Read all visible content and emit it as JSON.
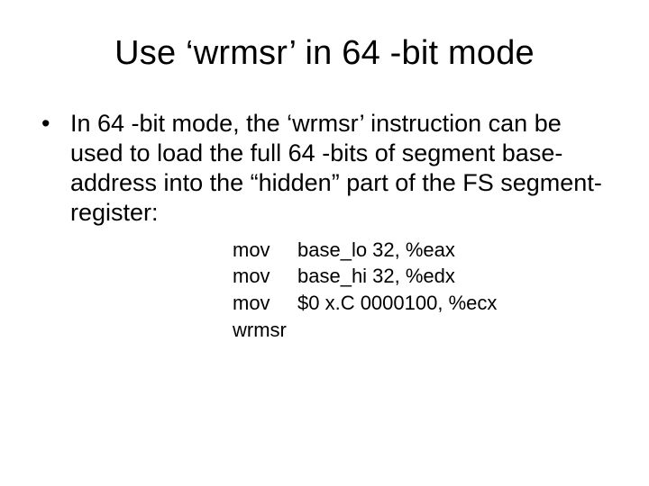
{
  "title": "Use ‘wrmsr’ in 64 -bit mode",
  "bullet": "In 64 -bit mode, the ‘wrmsr’ instruction can be used to load the full 64 -bits of segment base-address into the “hidden” part of the FS segment-register:",
  "code": {
    "lines": [
      {
        "mnemonic": "mov",
        "operands": "base_lo 32, %eax"
      },
      {
        "mnemonic": "mov",
        "operands": "base_hi 32, %edx"
      },
      {
        "mnemonic": "mov",
        "operands": "$0 x.C 0000100, %ecx"
      },
      {
        "mnemonic": "wrmsr",
        "operands": ""
      }
    ]
  }
}
